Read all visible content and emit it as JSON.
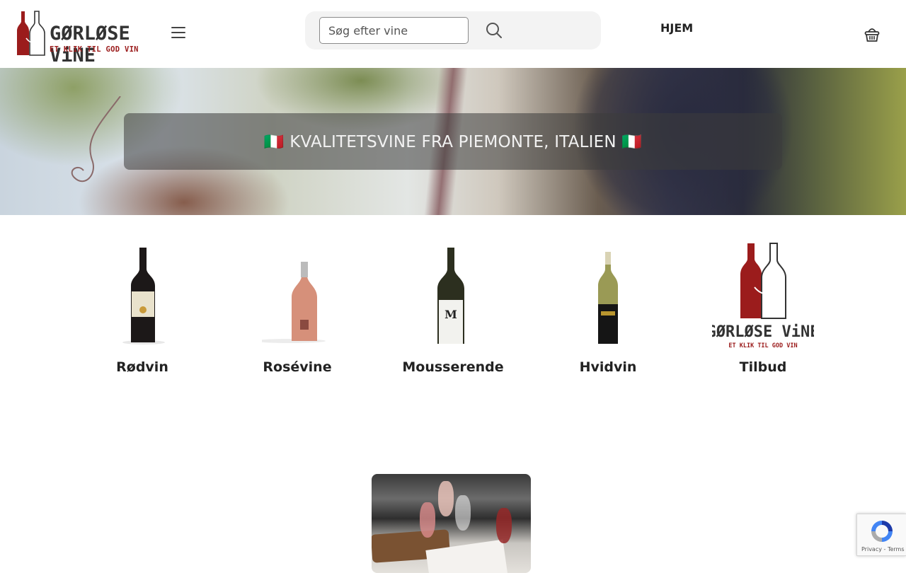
{
  "header": {
    "logo": {
      "name": "GØRLØSE ViNE",
      "tagline": "ET KLIK TIL GOD VIN",
      "primary_color": "#9b1c1c",
      "text_color": "#333333"
    },
    "menu_icon": "hamburger-icon",
    "search": {
      "placeholder": "Søg efter vine",
      "value": "",
      "button_icon": "search-icon"
    },
    "nav": {
      "home_label": "HJEM"
    },
    "cart_icon": "basket-icon"
  },
  "hero": {
    "banner_text": "🇮🇹 KVALITETSVINE FRA PIEMONTE, ITALIEN 🇮🇹"
  },
  "categories": [
    {
      "label": "Rødvin",
      "image": "red-wine-bottle"
    },
    {
      "label": "Rosévine",
      "image": "rose-sparkling-bottle"
    },
    {
      "label": "Mousserende",
      "image": "sparkling-white-bottle"
    },
    {
      "label": "Hvidvin",
      "image": "white-wine-bottle"
    },
    {
      "label": "Tilbud",
      "image": "gorlose-vine-logo"
    }
  ],
  "promo": {
    "image": "wine-tasting-table-photo"
  },
  "recaptcha": {
    "privacy_label": "Privacy",
    "separator": "-",
    "terms_label": "Terms"
  }
}
